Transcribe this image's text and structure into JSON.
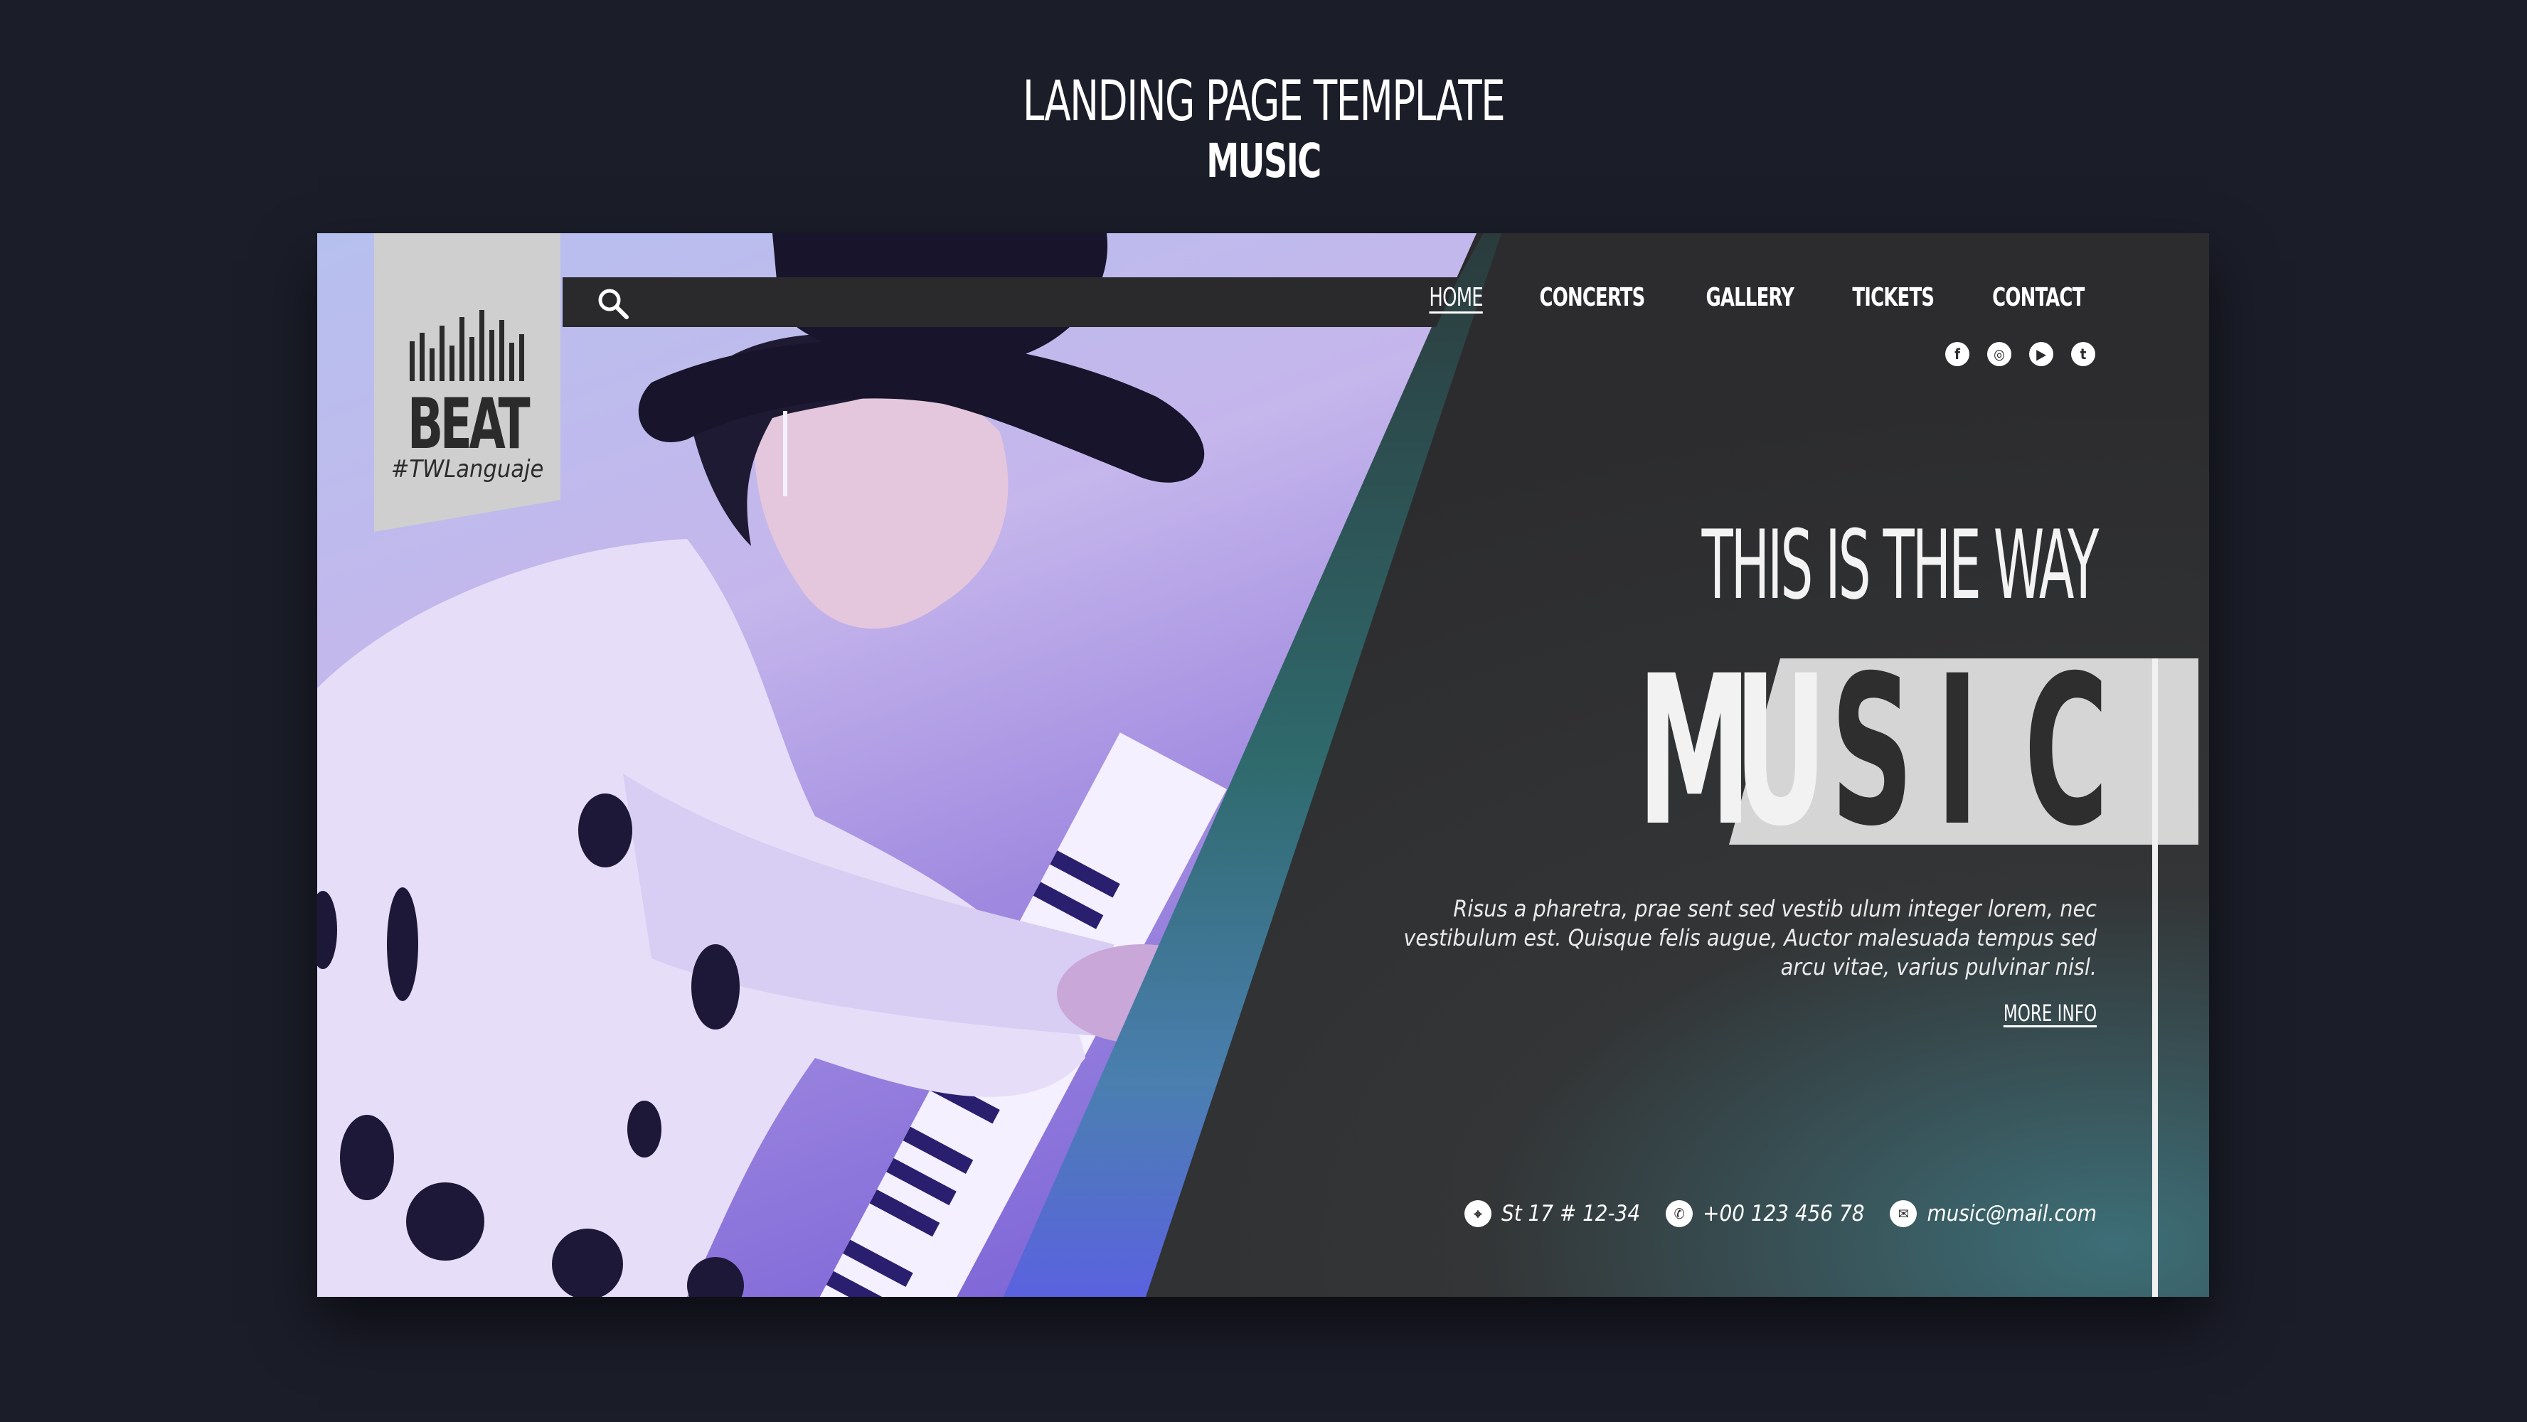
{
  "header": {
    "title": "LANDING PAGE TEMPLATE",
    "subtitle": "MUSIC"
  },
  "logo": {
    "word": "BEAT",
    "tag": "#TWLanguaje"
  },
  "nav": {
    "items": [
      {
        "label": "HOME",
        "active": true
      },
      {
        "label": "CONCERTS",
        "active": false
      },
      {
        "label": "GALLERY",
        "active": false
      },
      {
        "label": "TICKETS",
        "active": false
      },
      {
        "label": "CONTACT",
        "active": false
      }
    ]
  },
  "social": {
    "icons": [
      "facebook-icon",
      "instagram-icon",
      "youtube-icon",
      "twitter-icon"
    ],
    "glyphs": [
      "f",
      "◎",
      "▶",
      "t"
    ]
  },
  "hero": {
    "tagline": "THIS IS THE WAY",
    "word_letters": [
      "M",
      "U",
      "S",
      "I",
      "C"
    ],
    "description": "Risus a pharetra, prae sent sed vestib ulum integer lorem, nec vestibulum est. Quisque felis augue, Auctor malesuada tempus sed arcu vitae, varius pulvinar nisl.",
    "more_info": "MORE INFO"
  },
  "contact": {
    "address": "St 17 # 12-34",
    "phone": "+00 123 456 78",
    "email": "music@mail.com"
  },
  "colors": {
    "page_bg": "#1b1d29",
    "card_dark": "#2c2c2e",
    "accent_teal": "#2f6a6d",
    "accent_purple": "#7058d4",
    "strip_grey": "#d5d5d5"
  }
}
